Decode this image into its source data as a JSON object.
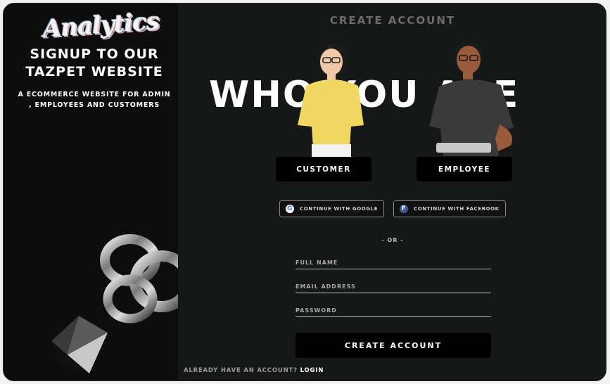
{
  "logo": {
    "text": "Analytics"
  },
  "left": {
    "title_line1": "Signup to our",
    "title_line2": "Tazpet website",
    "subtitle_line1": "A ecommerce website for admin",
    "subtitle_line2": ", employees and customers"
  },
  "main": {
    "heading": "Create Account",
    "hero_text": "Who you are",
    "roles": {
      "customer_label": "Customer",
      "employee_label": "Employee"
    },
    "social": {
      "google_label": "Continue with Google",
      "facebook_label": "Continue with Facebook"
    },
    "divider": "- OR -",
    "form": {
      "full_name_placeholder": "Full Name",
      "email_placeholder": "Email Address",
      "password_placeholder": "Password",
      "submit_label": "Create Account"
    },
    "footer": {
      "prompt": "Already have an account?",
      "login_label": "Login"
    }
  },
  "colors": {
    "panel_left": "#0d0d0d",
    "panel_right": "#161717",
    "button_bg": "#000000",
    "text_primary": "#ffffff",
    "customer_shirt": "#f0d760",
    "employee_shirt": "#3a3a3a",
    "google_blue": "#4285f4",
    "facebook_blue": "#3b5998"
  },
  "icons": [
    "google-icon",
    "facebook-icon"
  ]
}
